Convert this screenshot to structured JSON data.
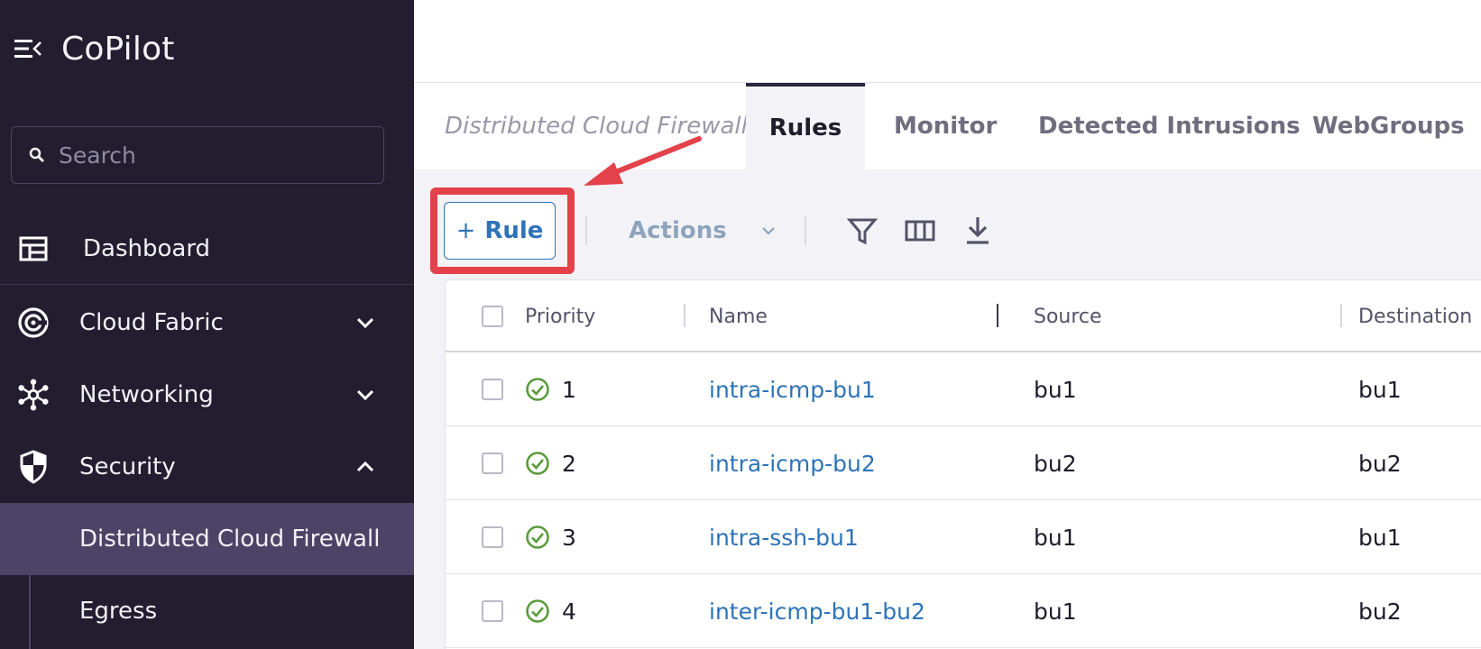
{
  "app": {
    "title": "CoPilot"
  },
  "search": {
    "placeholder": "Search"
  },
  "sidebar": {
    "items": [
      {
        "label": "Dashboard",
        "icon": "dashboard-icon"
      },
      {
        "label": "Cloud Fabric",
        "icon": "cloud-fabric-icon",
        "expanded": false
      },
      {
        "label": "Networking",
        "icon": "networking-icon",
        "expanded": false
      },
      {
        "label": "Security",
        "icon": "shield-icon",
        "expanded": true
      }
    ],
    "security_subitems": [
      {
        "label": "Distributed Cloud Firewall",
        "selected": true
      },
      {
        "label": "Egress",
        "selected": false
      }
    ]
  },
  "tabs": {
    "breadcrumb": "Distributed Cloud Firewall",
    "items": [
      "Rules",
      "Monitor",
      "Detected Intrusions",
      "WebGroups"
    ],
    "active": "Rules"
  },
  "toolbar": {
    "add_label": "Rule",
    "add_plus": "+",
    "actions_label": "Actions",
    "icons": [
      "filter-icon",
      "columns-icon",
      "download-icon"
    ]
  },
  "table": {
    "columns": [
      "Priority",
      "Name",
      "Source",
      "Destination"
    ],
    "rows": [
      {
        "priority": "1",
        "name": "intra-icmp-bu1",
        "source": "bu1",
        "destination": "bu1",
        "status": "enabled"
      },
      {
        "priority": "2",
        "name": "intra-icmp-bu2",
        "source": "bu2",
        "destination": "bu2",
        "status": "enabled"
      },
      {
        "priority": "3",
        "name": "intra-ssh-bu1",
        "source": "bu1",
        "destination": "bu1",
        "status": "enabled"
      },
      {
        "priority": "4",
        "name": "inter-icmp-bu1-bu2",
        "source": "bu1",
        "destination": "bu2",
        "status": "enabled"
      }
    ]
  },
  "colors": {
    "sidebar_bg": "#221e30",
    "selected_bg": "#4b4466",
    "link": "#2e73b8",
    "highlight": "#e3424a",
    "status_ok": "#5a9a3a"
  }
}
